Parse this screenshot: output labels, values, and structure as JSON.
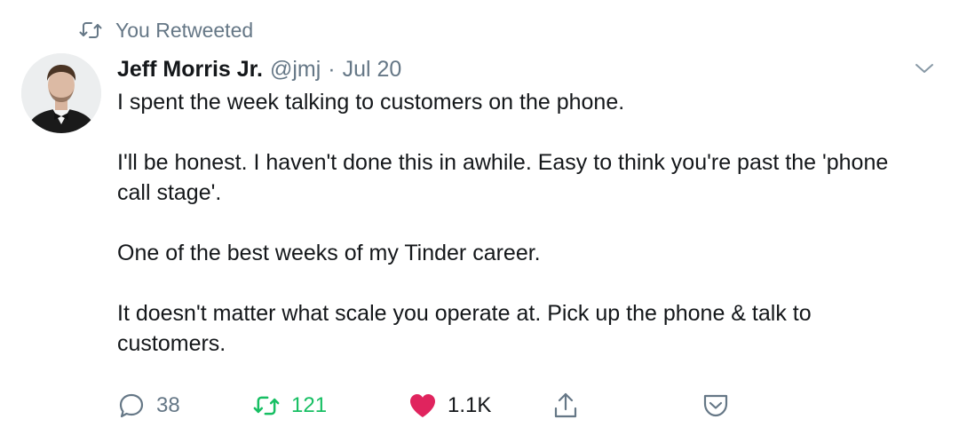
{
  "retweet_context": {
    "icon": "retweet-icon",
    "label": "You Retweeted"
  },
  "author": {
    "name": "Jeff Morris Jr.",
    "handle": "@jmj",
    "separator": "·",
    "date": "Jul 20"
  },
  "tweet": {
    "paragraphs": [
      "I spent the week talking to customers on the phone.",
      "I'll be honest. I haven't done this in awhile. Easy to think you're past the 'phone call stage'.",
      "One of the best weeks of my Tinder career.",
      "It doesn't matter what scale you operate at. Pick up the phone & talk to customers."
    ]
  },
  "actions": {
    "reply": {
      "icon": "reply-icon",
      "count": "38"
    },
    "retweet": {
      "icon": "retweet-icon",
      "count": "121",
      "active": true
    },
    "like": {
      "icon": "heart-icon",
      "count": "1.1K",
      "active": true
    },
    "share": {
      "icon": "share-icon"
    },
    "pocket": {
      "icon": "pocket-icon"
    }
  },
  "colors": {
    "retweet_active": "#17bf63",
    "like_active": "#e0245e",
    "secondary_text": "#657786",
    "primary_text": "#14171a"
  }
}
